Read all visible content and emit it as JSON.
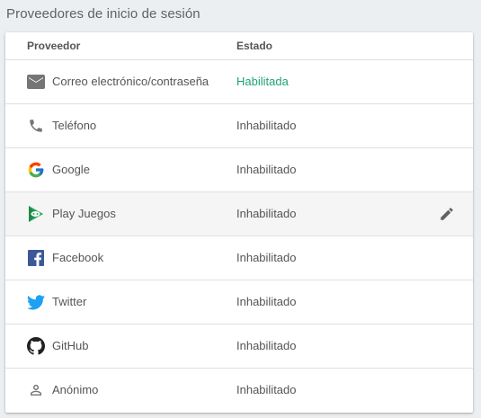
{
  "section_title": "Proveedores de inicio de sesión",
  "table": {
    "headers": {
      "provider": "Proveedor",
      "status": "Estado"
    },
    "rows": [
      {
        "name": "Correo electrónico/contraseña",
        "status": "Habilitada",
        "icon": "email-icon",
        "enabled": true
      },
      {
        "name": "Teléfono",
        "status": "Inhabilitado",
        "icon": "phone-icon",
        "enabled": false
      },
      {
        "name": "Google",
        "status": "Inhabilitado",
        "icon": "google-icon",
        "enabled": false
      },
      {
        "name": "Play Juegos",
        "status": "Inhabilitado",
        "icon": "play-games-icon",
        "enabled": false,
        "hovered": true
      },
      {
        "name": "Facebook",
        "status": "Inhabilitado",
        "icon": "facebook-icon",
        "enabled": false
      },
      {
        "name": "Twitter",
        "status": "Inhabilitado",
        "icon": "twitter-icon",
        "enabled": false
      },
      {
        "name": "GitHub",
        "status": "Inhabilitado",
        "icon": "github-icon",
        "enabled": false
      },
      {
        "name": "Anónimo",
        "status": "Inhabilitado",
        "icon": "anonymous-user-icon",
        "enabled": false
      }
    ]
  },
  "colors": {
    "enabled_status": "#1da27a",
    "disabled_status": "#555555",
    "hover_row": "#f5f5f5",
    "background": "#eceff1"
  },
  "edit_icon": "pencil-icon"
}
